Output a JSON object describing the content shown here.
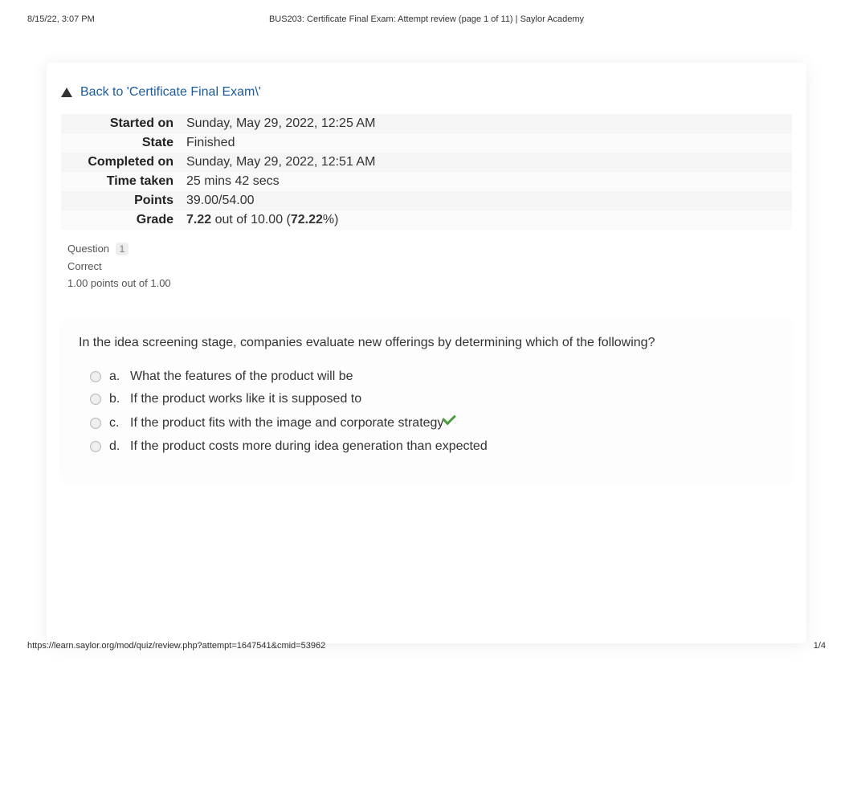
{
  "print": {
    "date": "8/15/22, 3:07 PM",
    "title": "BUS203: Certificate Final Exam: Attempt review (page 1 of 11) | Saylor Academy",
    "url": "https://learn.saylor.org/mod/quiz/review.php?attempt=1647541&cmid=53962",
    "page": "1/4"
  },
  "back_link": "Back to 'Certificate Final Exam\\'",
  "summary": {
    "started_on": {
      "label": "Started on",
      "value": "Sunday, May 29, 2022, 12:25 AM"
    },
    "state": {
      "label": "State",
      "value": "Finished"
    },
    "completed_on": {
      "label": "Completed on",
      "value": "Sunday, May 29, 2022, 12:51 AM"
    },
    "time_taken": {
      "label": "Time taken",
      "value": "25 mins 42 secs"
    },
    "points": {
      "label": "Points",
      "value": "39.00/54.00"
    },
    "grade": {
      "label": "Grade",
      "score": "7.22",
      "outof_pre": " out of 10.00 (",
      "percent": "72.22",
      "outof_post": "%)"
    }
  },
  "question": {
    "label": "Question",
    "number": "1",
    "status": "Correct",
    "points_text": "1.00 points out of 1.00",
    "text": "In the idea screening stage, companies evaluate new offerings by determining which of the following?",
    "options": [
      {
        "letter": "a.",
        "text": "What the features of the product will be",
        "correct": false
      },
      {
        "letter": "b.",
        "text": "If the product works like it is supposed to",
        "correct": false
      },
      {
        "letter": "c.",
        "text": "If the product fits with the image and corporate strategy",
        "correct": true
      },
      {
        "letter": "d.",
        "text": "If the product costs more during idea generation than expected",
        "correct": false
      }
    ]
  }
}
